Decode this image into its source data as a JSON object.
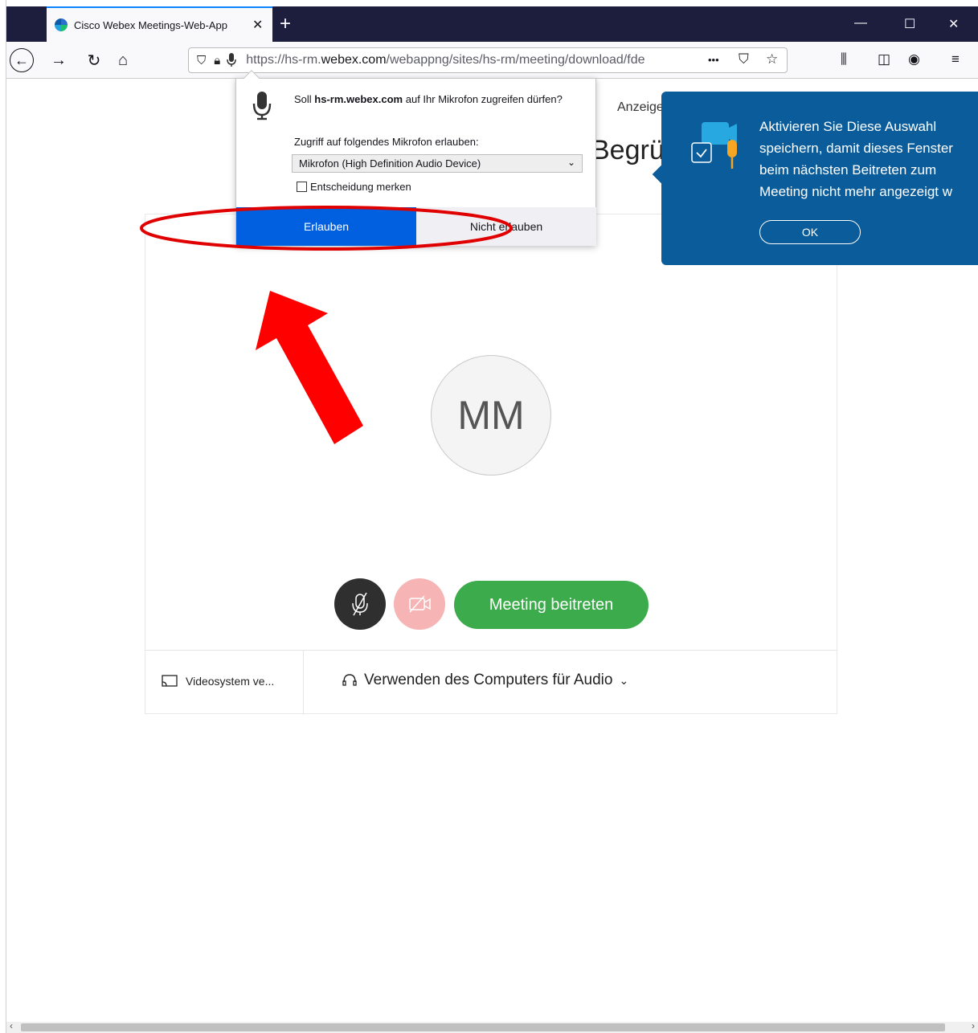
{
  "browser": {
    "tab_title": "Cisco Webex Meetings-Web-App",
    "tab_close": "✕",
    "new_tab": "+",
    "window_controls": {
      "minimize": "—",
      "maximize": "☐",
      "close": "✕"
    },
    "url_prefix": "https://hs-rm.",
    "url_domain": "webex.com",
    "url_rest": "/webappng/sites/hs-rm/meeting/download/fde",
    "url_more": "•••"
  },
  "permission_popup": {
    "question_prefix": "Soll ",
    "question_host": "hs-rm.webex.com",
    "question_suffix": " auf Ihr Mikrofon zugreifen dürfen?",
    "select_label": "Zugriff auf folgendes Mikrofon erlauben:",
    "select_value": "Mikrofon (High Definition Audio Device)",
    "remember_label": "Entscheidung merken",
    "allow_label": "Erlauben",
    "deny_label": "Nicht erlauben"
  },
  "page": {
    "anzeige_label": "Anzeige",
    "heading_fragment": "Begrü",
    "avatar_initials": "MM",
    "join_button": "Meeting beitreten",
    "video_system": "Videosystem ve...",
    "audio_option": "Verwenden des Computers für Audio"
  },
  "tip": {
    "line1": "Aktivieren Sie Diese Auswahl",
    "line2": "speichern, damit dieses Fenster",
    "line3": "beim nächsten Beitreten zum",
    "line4": "Meeting nicht mehr angezeigt w",
    "ok_label": "OK"
  },
  "colors": {
    "accent_blue": "#0060df",
    "webex_blue": "#0b5c9a",
    "join_green": "#3bab4b",
    "annotation_red": "#ff0000"
  }
}
